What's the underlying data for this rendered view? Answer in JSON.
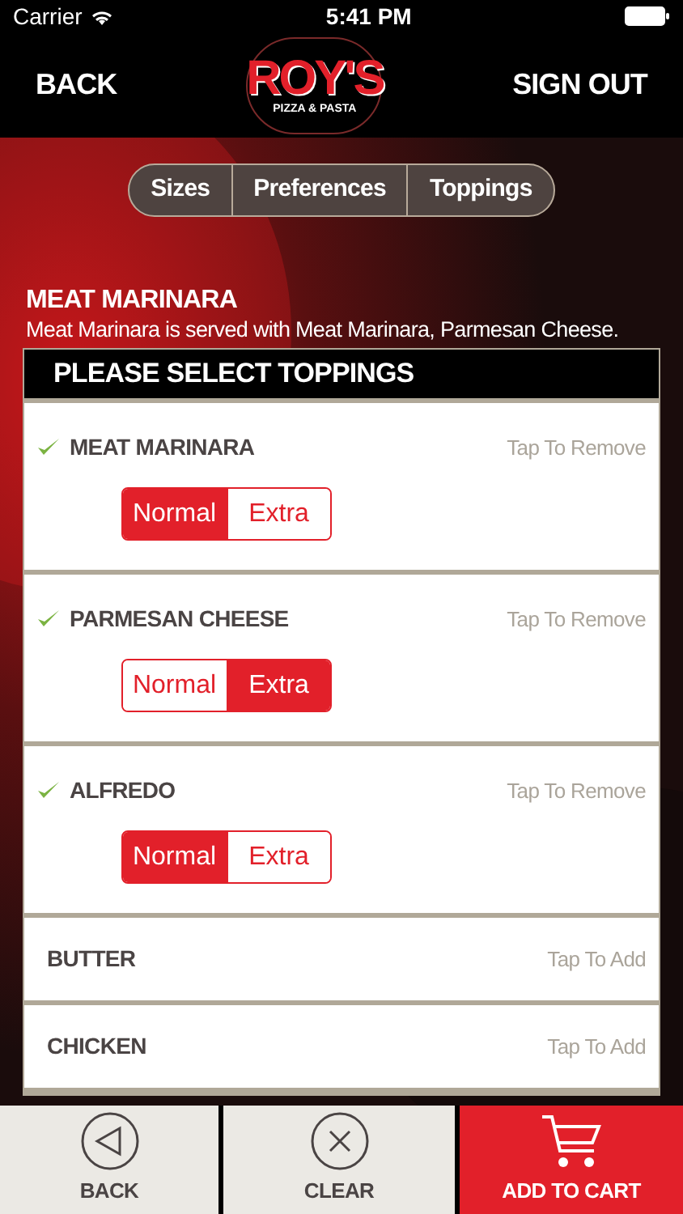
{
  "status_bar": {
    "carrier": "Carrier",
    "time": "5:41 PM"
  },
  "nav": {
    "back": "BACK",
    "logo": {
      "name": "ROY'S",
      "tagline": "PIZZA & PASTA"
    },
    "sign_out": "SIGN OUT"
  },
  "tabs": [
    {
      "label": "Sizes"
    },
    {
      "label": "Preferences"
    },
    {
      "label": "Toppings"
    }
  ],
  "item": {
    "title": "MEAT MARINARA",
    "description": "Meat Marinara is served with Meat Marinara, Parmesan Cheese."
  },
  "toppings_panel": {
    "header": "PLEASE SELECT TOPPINGS",
    "toppings": [
      {
        "name": "MEAT MARINARA",
        "checked": true,
        "action": "Tap To Remove",
        "options": [
          {
            "label": "Normal",
            "selected": true
          },
          {
            "label": "Extra",
            "selected": false
          }
        ]
      },
      {
        "name": "PARMESAN CHEESE",
        "checked": true,
        "action": "Tap To Remove",
        "options": [
          {
            "label": "Normal",
            "selected": false
          },
          {
            "label": "Extra",
            "selected": true
          }
        ]
      },
      {
        "name": "ALFREDO",
        "checked": true,
        "action": "Tap To Remove",
        "options": [
          {
            "label": "Normal",
            "selected": true
          },
          {
            "label": "Extra",
            "selected": false
          }
        ]
      },
      {
        "name": "BUTTER",
        "checked": false,
        "action": "Tap To Add"
      },
      {
        "name": "CHICKEN",
        "checked": false,
        "action": "Tap To Add"
      }
    ]
  },
  "bottom_bar": [
    {
      "kind": "back",
      "label": "BACK"
    },
    {
      "kind": "clear",
      "label": "CLEAR"
    },
    {
      "kind": "cart",
      "label": "ADD TO CART"
    }
  ]
}
